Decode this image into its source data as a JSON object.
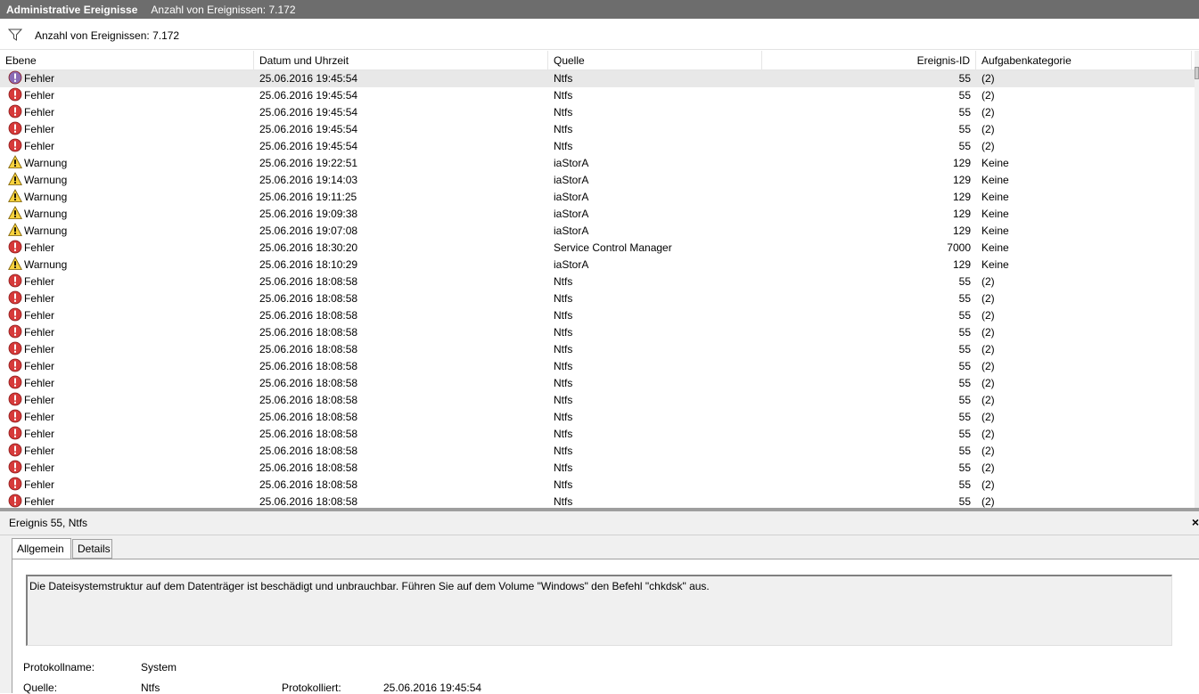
{
  "titlebar": {
    "title": "Administrative Ereignisse",
    "count": "Anzahl von Ereignissen: 7.172"
  },
  "filter": {
    "text": "Anzahl von Ereignissen: 7.172",
    "icon": "funnel-icon"
  },
  "columns": {
    "level": "Ebene",
    "date": "Datum und Uhrzeit",
    "source": "Quelle",
    "id": "Ereignis-ID",
    "category": "Aufgabenkategorie"
  },
  "colors": {
    "titlebar": "#6d6d6d",
    "error": "#d63a3a",
    "warning": "#f7d23e",
    "selected_row": "#e8e8e8"
  },
  "events": [
    {
      "type": "error",
      "level": "Fehler",
      "date": "25.06.2016 19:45:54",
      "source": "Ntfs",
      "id": "55",
      "category": "(2)"
    },
    {
      "type": "error",
      "level": "Fehler",
      "date": "25.06.2016 19:45:54",
      "source": "Ntfs",
      "id": "55",
      "category": "(2)"
    },
    {
      "type": "error",
      "level": "Fehler",
      "date": "25.06.2016 19:45:54",
      "source": "Ntfs",
      "id": "55",
      "category": "(2)"
    },
    {
      "type": "error",
      "level": "Fehler",
      "date": "25.06.2016 19:45:54",
      "source": "Ntfs",
      "id": "55",
      "category": "(2)"
    },
    {
      "type": "error",
      "level": "Fehler",
      "date": "25.06.2016 19:45:54",
      "source": "Ntfs",
      "id": "55",
      "category": "(2)"
    },
    {
      "type": "warning",
      "level": "Warnung",
      "date": "25.06.2016 19:22:51",
      "source": "iaStorA",
      "id": "129",
      "category": "Keine"
    },
    {
      "type": "warning",
      "level": "Warnung",
      "date": "25.06.2016 19:14:03",
      "source": "iaStorA",
      "id": "129",
      "category": "Keine"
    },
    {
      "type": "warning",
      "level": "Warnung",
      "date": "25.06.2016 19:11:25",
      "source": "iaStorA",
      "id": "129",
      "category": "Keine"
    },
    {
      "type": "warning",
      "level": "Warnung",
      "date": "25.06.2016 19:09:38",
      "source": "iaStorA",
      "id": "129",
      "category": "Keine"
    },
    {
      "type": "warning",
      "level": "Warnung",
      "date": "25.06.2016 19:07:08",
      "source": "iaStorA",
      "id": "129",
      "category": "Keine"
    },
    {
      "type": "error",
      "level": "Fehler",
      "date": "25.06.2016 18:30:20",
      "source": "Service Control Manager",
      "id": "7000",
      "category": "Keine"
    },
    {
      "type": "warning",
      "level": "Warnung",
      "date": "25.06.2016 18:10:29",
      "source": "iaStorA",
      "id": "129",
      "category": "Keine"
    },
    {
      "type": "error",
      "level": "Fehler",
      "date": "25.06.2016 18:08:58",
      "source": "Ntfs",
      "id": "55",
      "category": "(2)"
    },
    {
      "type": "error",
      "level": "Fehler",
      "date": "25.06.2016 18:08:58",
      "source": "Ntfs",
      "id": "55",
      "category": "(2)"
    },
    {
      "type": "error",
      "level": "Fehler",
      "date": "25.06.2016 18:08:58",
      "source": "Ntfs",
      "id": "55",
      "category": "(2)"
    },
    {
      "type": "error",
      "level": "Fehler",
      "date": "25.06.2016 18:08:58",
      "source": "Ntfs",
      "id": "55",
      "category": "(2)"
    },
    {
      "type": "error",
      "level": "Fehler",
      "date": "25.06.2016 18:08:58",
      "source": "Ntfs",
      "id": "55",
      "category": "(2)"
    },
    {
      "type": "error",
      "level": "Fehler",
      "date": "25.06.2016 18:08:58",
      "source": "Ntfs",
      "id": "55",
      "category": "(2)"
    },
    {
      "type": "error",
      "level": "Fehler",
      "date": "25.06.2016 18:08:58",
      "source": "Ntfs",
      "id": "55",
      "category": "(2)"
    },
    {
      "type": "error",
      "level": "Fehler",
      "date": "25.06.2016 18:08:58",
      "source": "Ntfs",
      "id": "55",
      "category": "(2)"
    },
    {
      "type": "error",
      "level": "Fehler",
      "date": "25.06.2016 18:08:58",
      "source": "Ntfs",
      "id": "55",
      "category": "(2)"
    },
    {
      "type": "error",
      "level": "Fehler",
      "date": "25.06.2016 18:08:58",
      "source": "Ntfs",
      "id": "55",
      "category": "(2)"
    },
    {
      "type": "error",
      "level": "Fehler",
      "date": "25.06.2016 18:08:58",
      "source": "Ntfs",
      "id": "55",
      "category": "(2)"
    },
    {
      "type": "error",
      "level": "Fehler",
      "date": "25.06.2016 18:08:58",
      "source": "Ntfs",
      "id": "55",
      "category": "(2)"
    },
    {
      "type": "error",
      "level": "Fehler",
      "date": "25.06.2016 18:08:58",
      "source": "Ntfs",
      "id": "55",
      "category": "(2)"
    },
    {
      "type": "error",
      "level": "Fehler",
      "date": "25.06.2016 18:08:58",
      "source": "Ntfs",
      "id": "55",
      "category": "(2)"
    }
  ],
  "detail": {
    "title": "Ereignis 55, Ntfs",
    "close": "×",
    "tabs": {
      "general": "Allgemein",
      "details": "Details"
    },
    "message": "Die Dateisystemstruktur auf dem Datenträger ist beschädigt und unbrauchbar. Führen Sie auf dem Volume \"Windows\" den Befehl \"chkdsk\" aus.",
    "log_name_label": "Protokollname:",
    "log_name": "System",
    "source_label": "Quelle:",
    "source": "Ntfs",
    "logged_label": "Protokolliert:",
    "logged": "25.06.2016 19:45:54"
  }
}
